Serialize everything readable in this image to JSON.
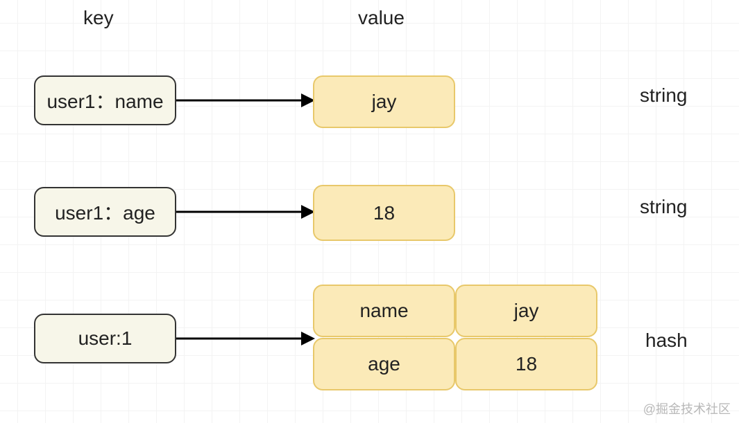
{
  "headers": {
    "key": "key",
    "value": "value"
  },
  "rows": [
    {
      "key": "user1：name",
      "value": "jay",
      "type": "string"
    },
    {
      "key": "user1：age",
      "value": "18",
      "type": "string"
    },
    {
      "key": "user:1",
      "type": "hash",
      "fields": [
        {
          "field": "name",
          "val": "jay"
        },
        {
          "field": "age",
          "val": "18"
        }
      ]
    }
  ],
  "watermark": "@掘金技术社区"
}
